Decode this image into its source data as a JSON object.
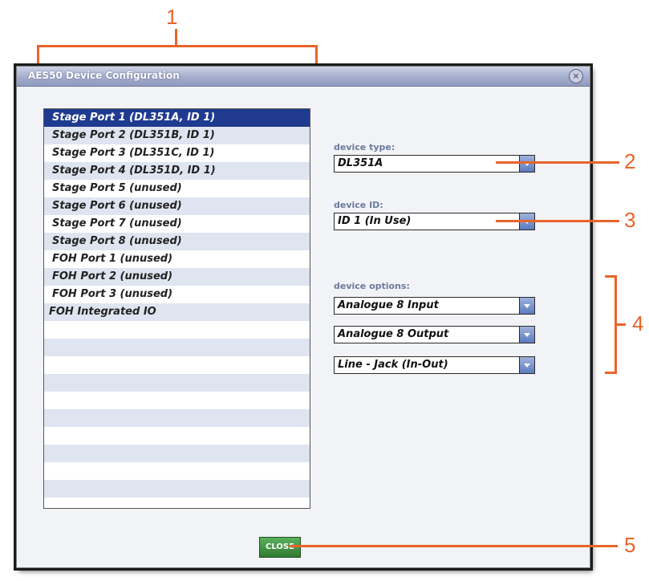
{
  "callouts": [
    "1",
    "2",
    "3",
    "4",
    "5"
  ],
  "dialog": {
    "title": "AES50 Device Configuration",
    "close_icon": "close-icon",
    "close_glyph": "×"
  },
  "ports": [
    {
      "label": "Stage Port 1 (DL351A, ID 1)",
      "selected": true
    },
    {
      "label": "Stage Port 2 (DL351B, ID 1)"
    },
    {
      "label": "Stage Port 3 (DL351C, ID 1)"
    },
    {
      "label": "Stage Port 4 (DL351D, ID 1)"
    },
    {
      "label": "Stage Port 5 (unused)"
    },
    {
      "label": "Stage Port 6 (unused)"
    },
    {
      "label": "Stage Port 7 (unused)"
    },
    {
      "label": "Stage Port 8 (unused)"
    },
    {
      "label": "FOH Port 1 (unused)"
    },
    {
      "label": "FOH Port 2 (unused)"
    },
    {
      "label": "FOH Port 3 (unused)"
    },
    {
      "label": "FOH Integrated IO"
    }
  ],
  "device_type": {
    "label": "device type:",
    "value": "DL351A"
  },
  "device_id": {
    "label": "device ID:",
    "value": "ID 1 (In Use)"
  },
  "device_options": {
    "label": "device options:",
    "values": [
      "Analogue 8 Input",
      "Analogue 8 Output",
      "Line - Jack (In-Out)"
    ]
  },
  "close_button": {
    "label": "CLOSE",
    "color": "#3a8a3e"
  },
  "accent_color": "#e8642a",
  "selected_color": "#1f3a8f"
}
